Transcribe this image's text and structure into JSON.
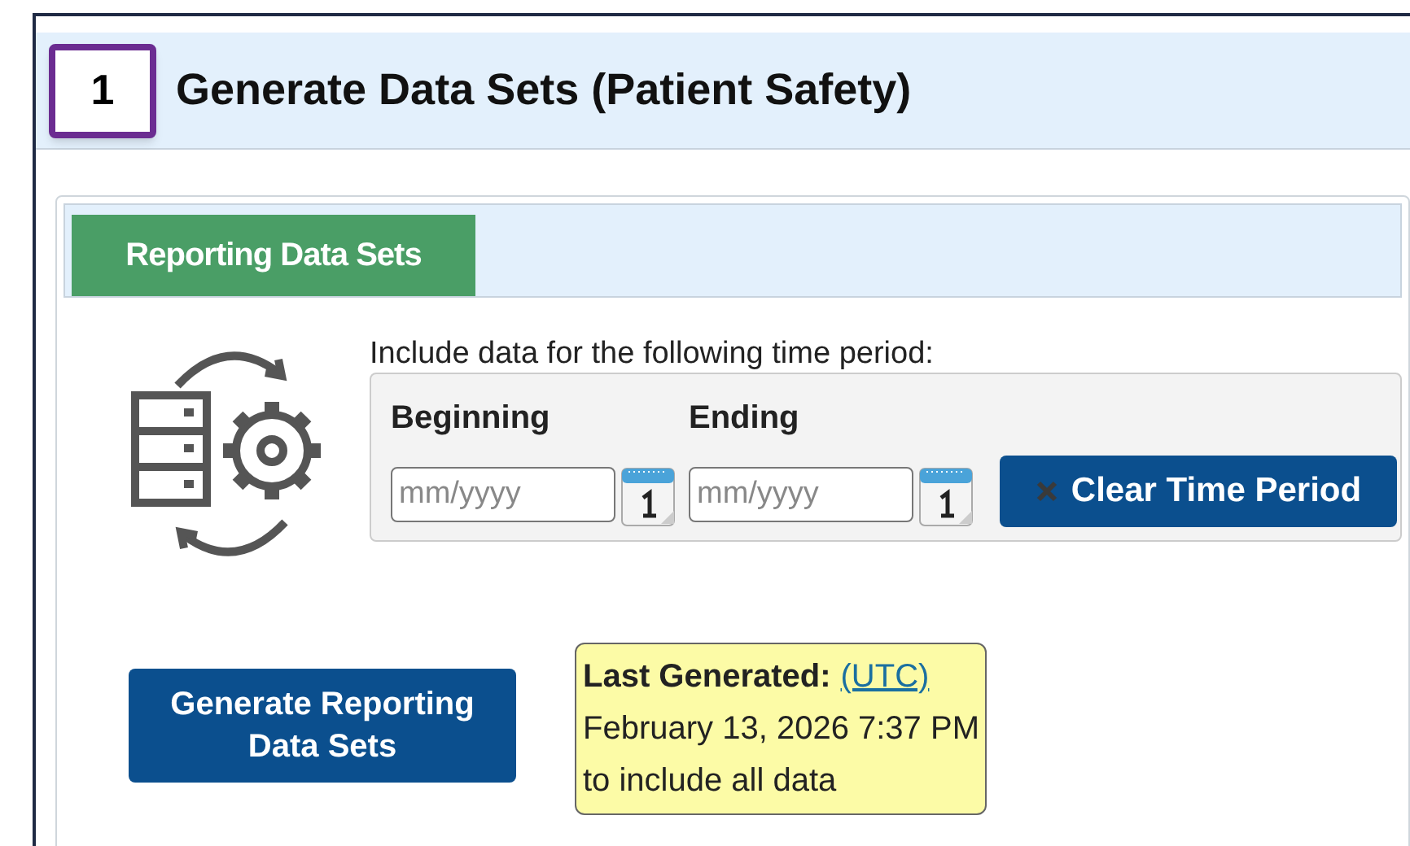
{
  "step_badge": "1",
  "title": "Generate Data Sets (Patient Safety)",
  "tabs": [
    {
      "label": "Reporting Data Sets",
      "selected": true
    }
  ],
  "time_period": {
    "prompt": "Include data for the following time period:",
    "fields": [
      {
        "label": "Beginning",
        "placeholder": "mm/yyyy"
      },
      {
        "label": "Ending",
        "placeholder": "mm/yyyy"
      }
    ],
    "clear_button": "Clear Time Period"
  },
  "generate_button": "Generate Reporting Data Sets",
  "last_generated": {
    "label": "Last Generated:",
    "link": "(UTC)",
    "date": "February 13, 2026 7:37 PM",
    "note": "to include all data"
  }
}
